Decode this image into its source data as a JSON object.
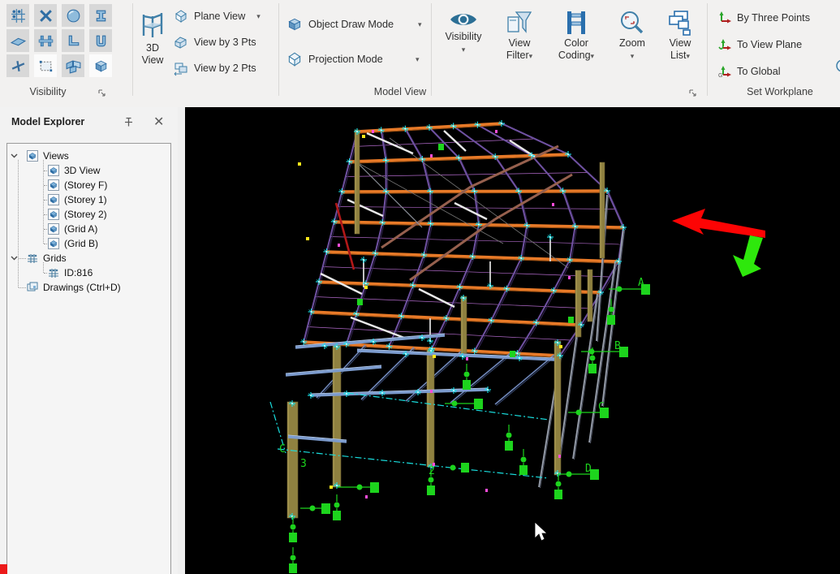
{
  "ribbon": {
    "groups": {
      "visibility": {
        "label": "Visibility",
        "icons": [
          "grid-points-icon",
          "cross-icon",
          "sphere-icon",
          "i-beam-icon",
          "plate-icon",
          "stiffened-beam-icon",
          "angle-icon",
          "channel-icon",
          "axes-icon",
          "selection-area-icon",
          "panels-icon",
          "solid-cube-icon"
        ]
      },
      "model_view": {
        "label": "Model View",
        "btn_3d_view": {
          "line1": "3D",
          "line2": "View"
        },
        "plane_view": "Plane View",
        "view_by_3": "View by 3 Pts",
        "view_by_2": "View by 2 Pts",
        "object_draw_mode": "Object Draw Mode",
        "projection_mode": "Projection Mode",
        "visibility": "Visibility",
        "view_filter_1": "View",
        "view_filter_2": "Filter",
        "color_coding_1": "Color",
        "color_coding_2": "Coding",
        "zoom": "Zoom",
        "view_list_1": "View",
        "view_list_2": "List"
      },
      "set_workplane": {
        "label": "Set Workplane",
        "by_three_points": "By Three Points",
        "to_view_plane": "To View Plane",
        "to_global": "To Global"
      }
    }
  },
  "explorer": {
    "title": "Model Explorer",
    "tree": [
      {
        "label": "Views",
        "level": 0,
        "icon": "view-icon",
        "expanded": true
      },
      {
        "label": "3D View",
        "level": 1,
        "icon": "view-icon"
      },
      {
        "label": "(Storey F)",
        "level": 1,
        "icon": "view-icon"
      },
      {
        "label": "(Storey 1)",
        "level": 1,
        "icon": "view-icon"
      },
      {
        "label": "(Storey 2)",
        "level": 1,
        "icon": "view-icon"
      },
      {
        "label": "(Grid A)",
        "level": 1,
        "icon": "view-icon"
      },
      {
        "label": "(Grid B)",
        "level": 1,
        "icon": "view-icon"
      },
      {
        "label": "Grids",
        "level": 0,
        "icon": "grid-icon",
        "expanded": true
      },
      {
        "label": "ID:816",
        "level": 1,
        "icon": "grid-icon"
      },
      {
        "label": "Drawings (Ctrl+D)",
        "level": 0,
        "icon": "drawings-icon"
      }
    ]
  },
  "viewport": {
    "grid_labels": {
      "right": [
        "A",
        "B",
        "C",
        "D"
      ],
      "floor_c": "C",
      "floor_3": "3",
      "floor_2": "2"
    },
    "colors": {
      "background": "#000000",
      "beam_orange": "#e87a28",
      "beam_orange_dark": "#a35312",
      "rafter_purple": "#6f51a1",
      "rafter_dark": "#31234f",
      "secondary_pink": "#b069c9",
      "steel_blue": "#7c9bcd",
      "steel_blue_light": "#b6cbe9",
      "girt_blue": "#7088bb",
      "rail_gray": "#9aa1ae",
      "rail_dark": "#5a6070",
      "column_olive": "#8f8140",
      "column_olive_edge": "#6b6030",
      "node_cyan": "#19e8f0",
      "support_green": "#1dd41d",
      "marker_magenta": "#ff4ddb",
      "marker_yellow": "#ffe81a",
      "brace_white": "#e9e9e9",
      "brace_brown": "#96604e",
      "brace_red": "#b11818",
      "dash_cyan": "#19dede",
      "axis_red": "#fd0404",
      "axis_green": "#2ee80c"
    }
  }
}
